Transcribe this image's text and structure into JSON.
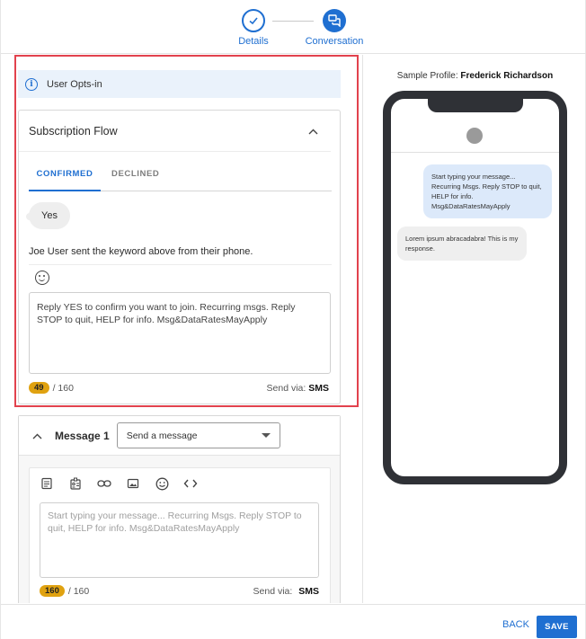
{
  "stepper": {
    "steps": [
      {
        "label": "Details",
        "state": "done"
      },
      {
        "label": "Conversation",
        "state": "active"
      }
    ]
  },
  "info": {
    "text": "User Opts-in"
  },
  "subscription_flow": {
    "title": "Subscription Flow",
    "tabs": [
      {
        "label": "CONFIRMED",
        "active": true
      },
      {
        "label": "DECLINED",
        "active": false
      }
    ],
    "keyword_bubble": "Yes",
    "keyword_note": "Joe User sent the keyword above from their phone.",
    "message_text": "Reply YES to confirm you want to join. Recurring msgs. Reply STOP to quit, HELP for info. Msg&DataRatesMayApply",
    "char_count": "49",
    "char_limit": "/ 160",
    "send_via_label": "Send via:",
    "send_via_value": "SMS"
  },
  "message1": {
    "label": "Message 1",
    "select_value": "Send a message",
    "placeholder": "Start typing your message... Recurring Msgs. Reply STOP to quit, HELP for info. Msg&DataRatesMayApply",
    "char_count": "160",
    "char_limit": "/ 160",
    "send_via_label": "Send via:",
    "send_via_value": "SMS"
  },
  "preview": {
    "sample_label": "Sample Profile:",
    "profile_name": "Frederick Richardson",
    "outgoing": "Start typing your message... Recurring Msgs. Reply STOP to quit, HELP for info. Msg&DataRatesMayApply",
    "incoming": "Lorem ipsum abracadabra! This is my response."
  },
  "footer": {
    "back_label": "BACK",
    "save_label": "SAVE"
  },
  "colors": {
    "accent": "#1f6fd1",
    "highlight_outline": "#e2424d",
    "counter_pill": "#e0a210"
  }
}
